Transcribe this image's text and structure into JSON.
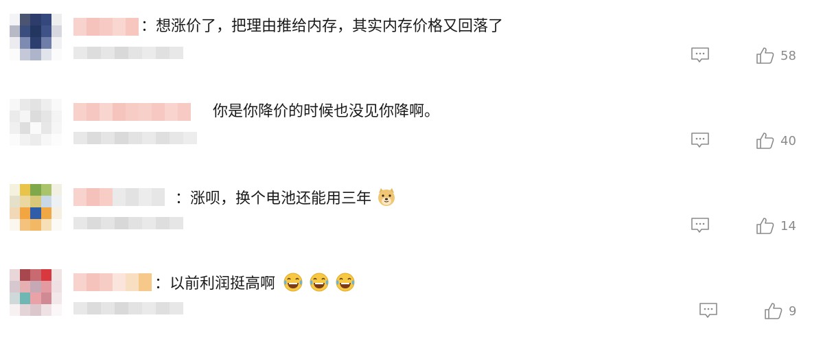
{
  "comments": [
    {
      "prefix": "：",
      "text": "想涨价了，把理由推给内存，其实内存价格又回落了",
      "likes": "58",
      "emojis": []
    },
    {
      "prefix": "",
      "text": "你是你降价的时候也没见你降啊。",
      "likes": "40",
      "emojis": []
    },
    {
      "prefix": "：",
      "text": "涨呗，换个电池还能用三年",
      "likes": "14",
      "emojis": [
        "doge-emoji"
      ]
    },
    {
      "prefix": "：",
      "text": "以前利润挺高啊",
      "likes": "9",
      "emojis": [
        "laugh-cry-emoji",
        "laugh-cry-emoji",
        "laugh-cry-emoji"
      ]
    }
  ],
  "icons": {
    "reply": "reply-icon",
    "like": "thumbs-up-icon"
  },
  "colors": {
    "text": "#1a1a1a",
    "muted": "#8a8a8a",
    "name_blur": "#f6c3bd",
    "meta_blur": "#e6e6e6"
  }
}
